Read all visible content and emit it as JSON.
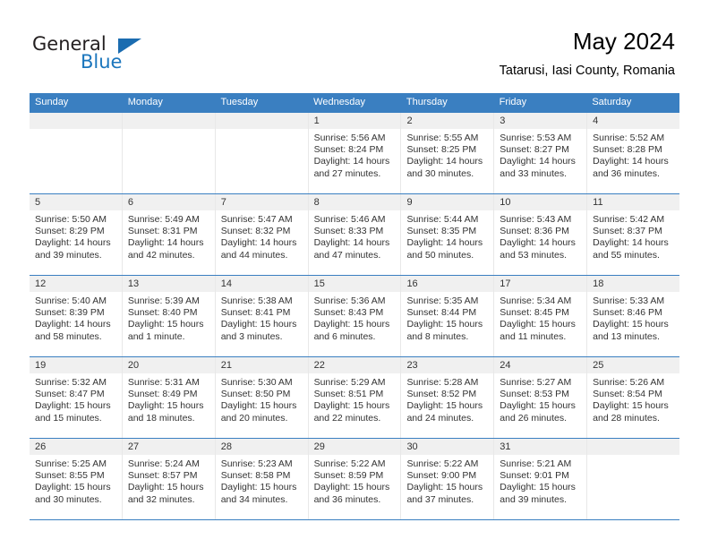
{
  "brand": {
    "name_part1": "General",
    "name_part2": "Blue",
    "triangle_icon": "triangle-icon",
    "accent_color": "#1b76bd"
  },
  "header": {
    "title": "May 2024",
    "subtitle": "Tatarusi, Iasi County, Romania"
  },
  "theme": {
    "header_bg": "#3a7fc1",
    "daynum_band_bg": "#f0f0f0",
    "text_color": "#333333"
  },
  "weekdays": [
    {
      "label": "Sunday"
    },
    {
      "label": "Monday"
    },
    {
      "label": "Tuesday"
    },
    {
      "label": "Wednesday"
    },
    {
      "label": "Thursday"
    },
    {
      "label": "Friday"
    },
    {
      "label": "Saturday"
    }
  ],
  "weeks": [
    [
      {
        "day": "",
        "sunrise": "",
        "sunset": "",
        "daylight_line1": "",
        "daylight_line2": ""
      },
      {
        "day": "",
        "sunrise": "",
        "sunset": "",
        "daylight_line1": "",
        "daylight_line2": ""
      },
      {
        "day": "",
        "sunrise": "",
        "sunset": "",
        "daylight_line1": "",
        "daylight_line2": ""
      },
      {
        "day": "1",
        "sunrise": "Sunrise: 5:56 AM",
        "sunset": "Sunset: 8:24 PM",
        "daylight_line1": "Daylight: 14 hours",
        "daylight_line2": "and 27 minutes."
      },
      {
        "day": "2",
        "sunrise": "Sunrise: 5:55 AM",
        "sunset": "Sunset: 8:25 PM",
        "daylight_line1": "Daylight: 14 hours",
        "daylight_line2": "and 30 minutes."
      },
      {
        "day": "3",
        "sunrise": "Sunrise: 5:53 AM",
        "sunset": "Sunset: 8:27 PM",
        "daylight_line1": "Daylight: 14 hours",
        "daylight_line2": "and 33 minutes."
      },
      {
        "day": "4",
        "sunrise": "Sunrise: 5:52 AM",
        "sunset": "Sunset: 8:28 PM",
        "daylight_line1": "Daylight: 14 hours",
        "daylight_line2": "and 36 minutes."
      }
    ],
    [
      {
        "day": "5",
        "sunrise": "Sunrise: 5:50 AM",
        "sunset": "Sunset: 8:29 PM",
        "daylight_line1": "Daylight: 14 hours",
        "daylight_line2": "and 39 minutes."
      },
      {
        "day": "6",
        "sunrise": "Sunrise: 5:49 AM",
        "sunset": "Sunset: 8:31 PM",
        "daylight_line1": "Daylight: 14 hours",
        "daylight_line2": "and 42 minutes."
      },
      {
        "day": "7",
        "sunrise": "Sunrise: 5:47 AM",
        "sunset": "Sunset: 8:32 PM",
        "daylight_line1": "Daylight: 14 hours",
        "daylight_line2": "and 44 minutes."
      },
      {
        "day": "8",
        "sunrise": "Sunrise: 5:46 AM",
        "sunset": "Sunset: 8:33 PM",
        "daylight_line1": "Daylight: 14 hours",
        "daylight_line2": "and 47 minutes."
      },
      {
        "day": "9",
        "sunrise": "Sunrise: 5:44 AM",
        "sunset": "Sunset: 8:35 PM",
        "daylight_line1": "Daylight: 14 hours",
        "daylight_line2": "and 50 minutes."
      },
      {
        "day": "10",
        "sunrise": "Sunrise: 5:43 AM",
        "sunset": "Sunset: 8:36 PM",
        "daylight_line1": "Daylight: 14 hours",
        "daylight_line2": "and 53 minutes."
      },
      {
        "day": "11",
        "sunrise": "Sunrise: 5:42 AM",
        "sunset": "Sunset: 8:37 PM",
        "daylight_line1": "Daylight: 14 hours",
        "daylight_line2": "and 55 minutes."
      }
    ],
    [
      {
        "day": "12",
        "sunrise": "Sunrise: 5:40 AM",
        "sunset": "Sunset: 8:39 PM",
        "daylight_line1": "Daylight: 14 hours",
        "daylight_line2": "and 58 minutes."
      },
      {
        "day": "13",
        "sunrise": "Sunrise: 5:39 AM",
        "sunset": "Sunset: 8:40 PM",
        "daylight_line1": "Daylight: 15 hours",
        "daylight_line2": "and 1 minute."
      },
      {
        "day": "14",
        "sunrise": "Sunrise: 5:38 AM",
        "sunset": "Sunset: 8:41 PM",
        "daylight_line1": "Daylight: 15 hours",
        "daylight_line2": "and 3 minutes."
      },
      {
        "day": "15",
        "sunrise": "Sunrise: 5:36 AM",
        "sunset": "Sunset: 8:43 PM",
        "daylight_line1": "Daylight: 15 hours",
        "daylight_line2": "and 6 minutes."
      },
      {
        "day": "16",
        "sunrise": "Sunrise: 5:35 AM",
        "sunset": "Sunset: 8:44 PM",
        "daylight_line1": "Daylight: 15 hours",
        "daylight_line2": "and 8 minutes."
      },
      {
        "day": "17",
        "sunrise": "Sunrise: 5:34 AM",
        "sunset": "Sunset: 8:45 PM",
        "daylight_line1": "Daylight: 15 hours",
        "daylight_line2": "and 11 minutes."
      },
      {
        "day": "18",
        "sunrise": "Sunrise: 5:33 AM",
        "sunset": "Sunset: 8:46 PM",
        "daylight_line1": "Daylight: 15 hours",
        "daylight_line2": "and 13 minutes."
      }
    ],
    [
      {
        "day": "19",
        "sunrise": "Sunrise: 5:32 AM",
        "sunset": "Sunset: 8:47 PM",
        "daylight_line1": "Daylight: 15 hours",
        "daylight_line2": "and 15 minutes."
      },
      {
        "day": "20",
        "sunrise": "Sunrise: 5:31 AM",
        "sunset": "Sunset: 8:49 PM",
        "daylight_line1": "Daylight: 15 hours",
        "daylight_line2": "and 18 minutes."
      },
      {
        "day": "21",
        "sunrise": "Sunrise: 5:30 AM",
        "sunset": "Sunset: 8:50 PM",
        "daylight_line1": "Daylight: 15 hours",
        "daylight_line2": "and 20 minutes."
      },
      {
        "day": "22",
        "sunrise": "Sunrise: 5:29 AM",
        "sunset": "Sunset: 8:51 PM",
        "daylight_line1": "Daylight: 15 hours",
        "daylight_line2": "and 22 minutes."
      },
      {
        "day": "23",
        "sunrise": "Sunrise: 5:28 AM",
        "sunset": "Sunset: 8:52 PM",
        "daylight_line1": "Daylight: 15 hours",
        "daylight_line2": "and 24 minutes."
      },
      {
        "day": "24",
        "sunrise": "Sunrise: 5:27 AM",
        "sunset": "Sunset: 8:53 PM",
        "daylight_line1": "Daylight: 15 hours",
        "daylight_line2": "and 26 minutes."
      },
      {
        "day": "25",
        "sunrise": "Sunrise: 5:26 AM",
        "sunset": "Sunset: 8:54 PM",
        "daylight_line1": "Daylight: 15 hours",
        "daylight_line2": "and 28 minutes."
      }
    ],
    [
      {
        "day": "26",
        "sunrise": "Sunrise: 5:25 AM",
        "sunset": "Sunset: 8:55 PM",
        "daylight_line1": "Daylight: 15 hours",
        "daylight_line2": "and 30 minutes."
      },
      {
        "day": "27",
        "sunrise": "Sunrise: 5:24 AM",
        "sunset": "Sunset: 8:57 PM",
        "daylight_line1": "Daylight: 15 hours",
        "daylight_line2": "and 32 minutes."
      },
      {
        "day": "28",
        "sunrise": "Sunrise: 5:23 AM",
        "sunset": "Sunset: 8:58 PM",
        "daylight_line1": "Daylight: 15 hours",
        "daylight_line2": "and 34 minutes."
      },
      {
        "day": "29",
        "sunrise": "Sunrise: 5:22 AM",
        "sunset": "Sunset: 8:59 PM",
        "daylight_line1": "Daylight: 15 hours",
        "daylight_line2": "and 36 minutes."
      },
      {
        "day": "30",
        "sunrise": "Sunrise: 5:22 AM",
        "sunset": "Sunset: 9:00 PM",
        "daylight_line1": "Daylight: 15 hours",
        "daylight_line2": "and 37 minutes."
      },
      {
        "day": "31",
        "sunrise": "Sunrise: 5:21 AM",
        "sunset": "Sunset: 9:01 PM",
        "daylight_line1": "Daylight: 15 hours",
        "daylight_line2": "and 39 minutes."
      },
      {
        "day": "",
        "sunrise": "",
        "sunset": "",
        "daylight_line1": "",
        "daylight_line2": ""
      }
    ]
  ]
}
